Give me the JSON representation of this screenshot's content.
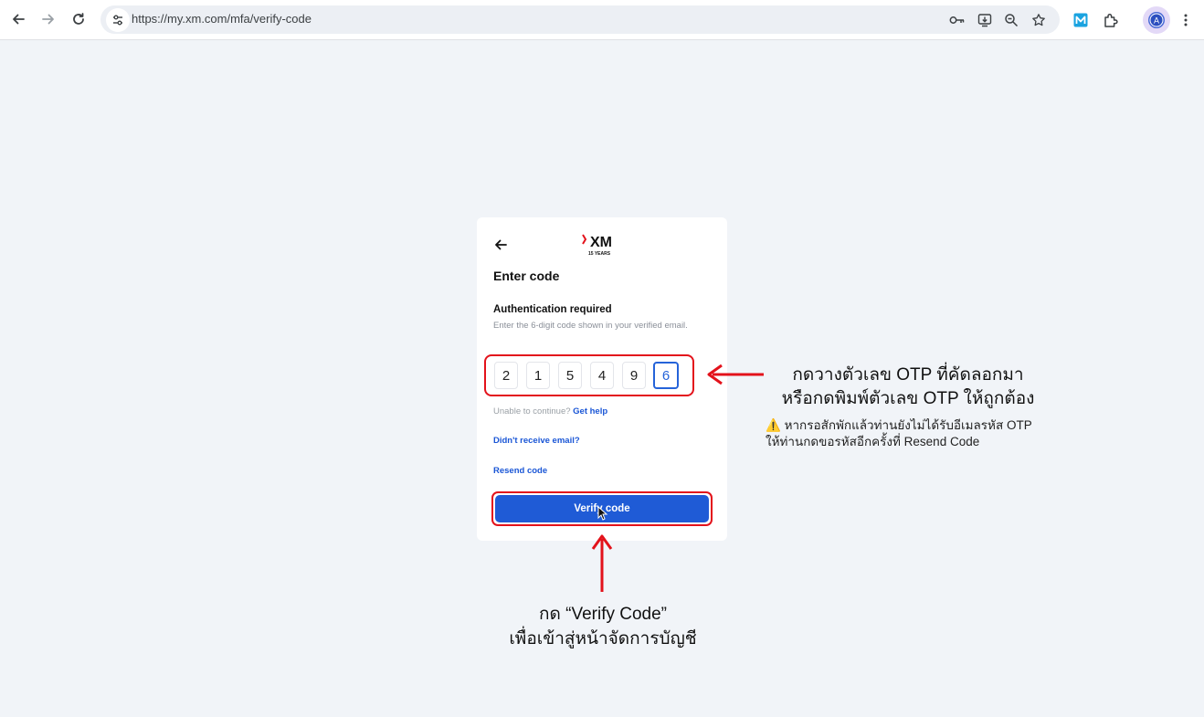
{
  "browser": {
    "url": "https://my.xm.com/mfa/verify-code"
  },
  "card": {
    "logo_text": "XM",
    "logo_sub": "15 YEARS",
    "title": "Enter code",
    "auth_title": "Authentication required",
    "auth_desc": "Enter the 6-digit code shown in your verified email.",
    "otp_digits": [
      "2",
      "1",
      "5",
      "4",
      "9",
      "6"
    ],
    "help_prefix": "Unable to continue?",
    "help_link": "Get help",
    "didnt_receive": "Didn't receive email?",
    "resend": "Resend code",
    "verify_button": "Verify code"
  },
  "annotations": {
    "right_line1": "กดวางตัวเลข OTP ที่คัดลอกมา",
    "right_line2": "หรือกดพิมพ์ตัวเลข OTP ให้ถูกต้อง",
    "warning_icon": "⚠️",
    "warning_line1": "หากรอสักพักแล้วท่านยังไม่ได้รับอีเมลรหัส OTP",
    "warning_line2": "ให้ท่านกดขอรหัสอีกครั้งที่ Resend Code",
    "bottom_line1": "กด “Verify Code”",
    "bottom_line2": "เพื่อเข้าสู่หน้าจัดการบัญชี"
  },
  "colors": {
    "accent": "#1f5bd6",
    "highlight": "#e3121b",
    "background": "#f1f4f8"
  }
}
